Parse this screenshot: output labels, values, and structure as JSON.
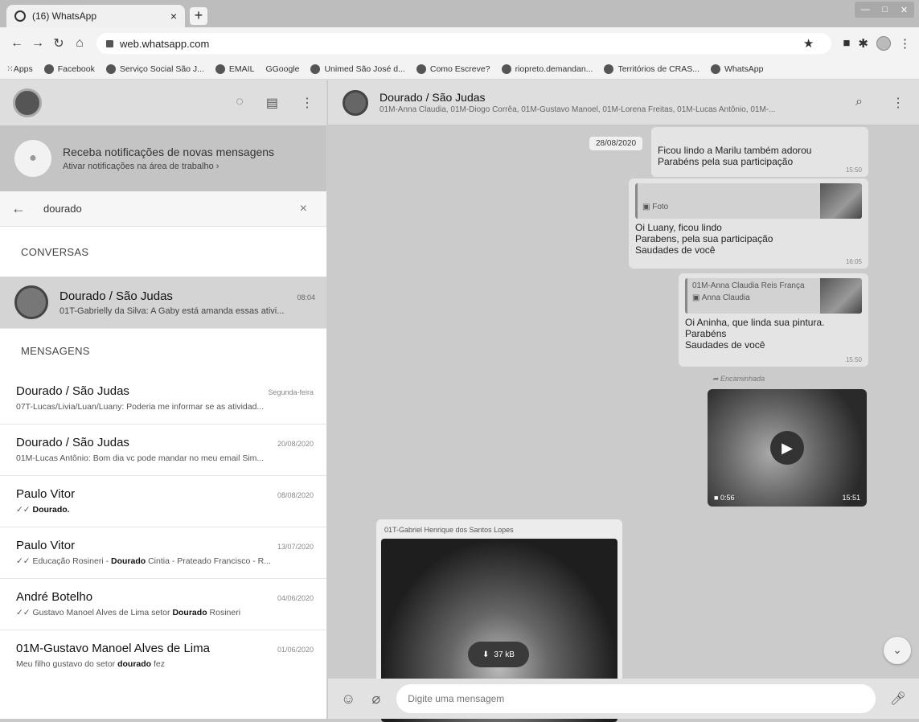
{
  "browser": {
    "tab_title": "(16) WhatsApp",
    "url": "web.whatsapp.com",
    "bookmarks": [
      "Apps",
      "Facebook",
      "Serviço Social São J...",
      "EMAIL",
      "Google",
      "Unimed São José d...",
      "Como Escreve?",
      "riopreto.demandan...",
      "Territórios de CRAS...",
      "WhatsApp"
    ]
  },
  "sidebar": {
    "notification": {
      "title": "Receba notificações de novas mensagens",
      "subtitle": "Ativar notificações na área de trabalho ›"
    },
    "search": {
      "value": "dourado"
    },
    "conversations_label": "CONVERSAS",
    "conversation": {
      "name": "Dourado / São Judas",
      "time": "08:04",
      "preview": "01T-Gabrielly da Silva: A Gaby está amanda essas ativi..."
    },
    "messages_label": "MENSAGENS",
    "messages": [
      {
        "name": "Dourado / São Judas",
        "date": "Segunda-feira",
        "preview": "07T-Lucas/Livia/Luan/Luany: Poderia me informar se as atividad..."
      },
      {
        "name": "Dourado / São Judas",
        "date": "20/08/2020",
        "preview": "01M-Lucas Antônio: Bom dia vc pode mandar no meu email Sim..."
      },
      {
        "name": "Paulo Vitor",
        "date": "08/08/2020",
        "preview_pre": "✓✓ ",
        "preview_bold": "Dourado.",
        "preview_post": ""
      },
      {
        "name": "Paulo Vitor",
        "date": "13/07/2020",
        "preview_pre": "✓✓ Educação  Rosineri - ",
        "preview_bold": "Dourado",
        "preview_post": " Cintia - Prateado Francisco - R..."
      },
      {
        "name": "André Botelho",
        "date": "04/06/2020",
        "preview_pre": "✓✓ Gustavo Manoel Alves de Lima setor ",
        "preview_bold": "Dourado",
        "preview_post": " Rosineri"
      },
      {
        "name": "01M-Gustavo Manoel Alves de Lima",
        "date": "01/06/2020",
        "preview_pre": "Meu filho gustavo do setor ",
        "preview_bold": "dourado",
        "preview_post": " fez"
      }
    ]
  },
  "chat": {
    "title": "Dourado / São Judas",
    "subtitle": "01M-Anna Claudia, 01M-Diogo Corrêa, 01M-Gustavo Manoel, 01M-Lorena Freitas, 01M-Lucas Antônio, 01M-...",
    "date_chip": "28/08/2020",
    "bubble1": {
      "line1": "Ficou lindo a Marilu também adorou",
      "line2": "Parabéns pela sua participação",
      "time": "15:50"
    },
    "bubble2": {
      "quote_label": "Foto",
      "line1": "Oi Luany, ficou lindo",
      "line2": "Parabens, pela sua participação",
      "line3": "Saudades de você",
      "time": "16:05"
    },
    "bubble3": {
      "quote_name": "01M-Anna Claudia Reis França",
      "quote_label": "Anna Claudia",
      "line1": "Oi Aninha, que linda sua pintura.",
      "line2": "Parabéns",
      "line3": "Saudades de você",
      "time": "15:50"
    },
    "forwarded": "Encaminhada",
    "video": {
      "duration": "0:56",
      "time": "15:51"
    },
    "image_msg": {
      "sender": "01T-Gabriel Henrique dos Santos Lopes",
      "size": "37 kB"
    },
    "composer_placeholder": "Digite uma mensagem"
  }
}
